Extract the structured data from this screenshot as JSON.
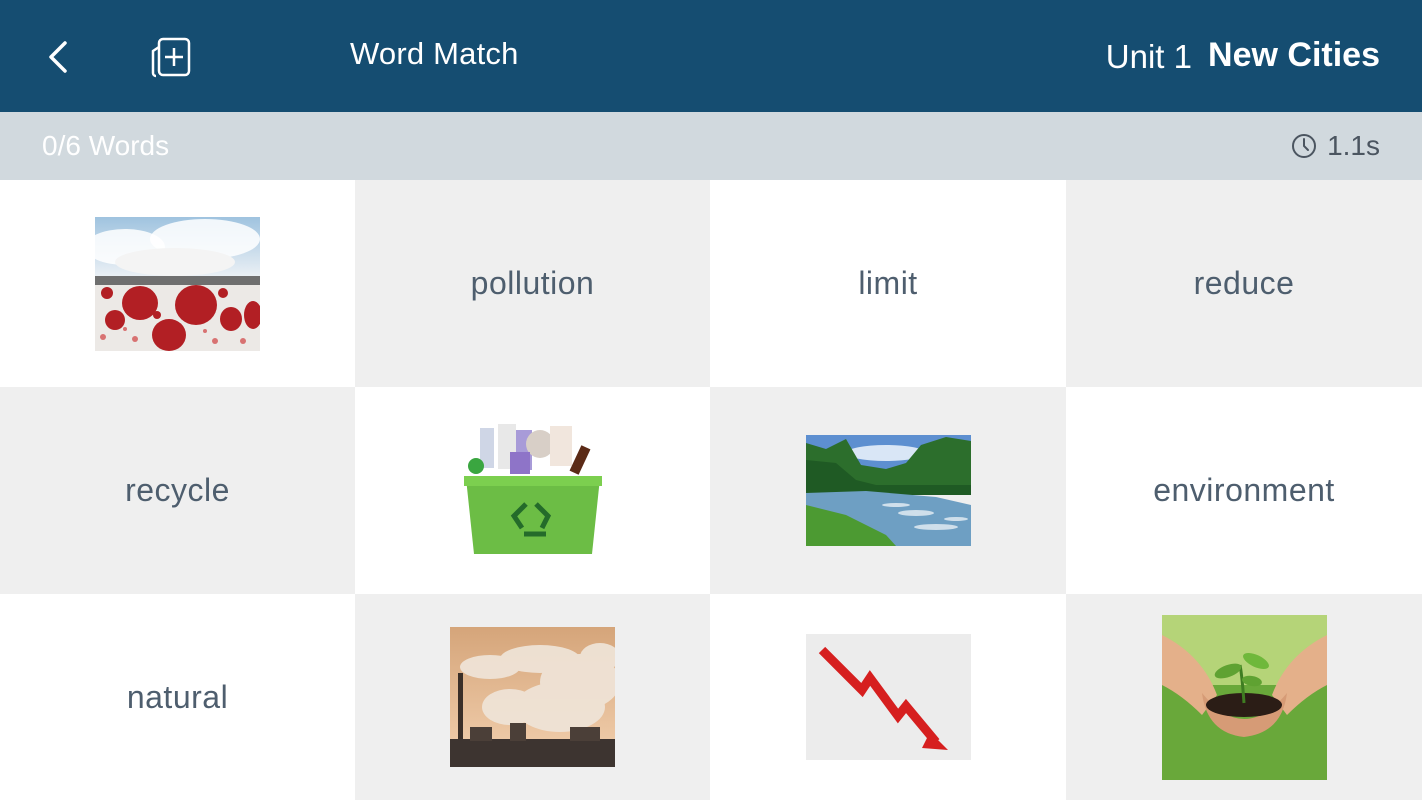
{
  "header": {
    "title": "Word Match",
    "unit": "Unit 1",
    "lesson": "New Cities",
    "back_icon": "chevron-left-icon",
    "add_icon": "add-card-icon",
    "background": "#154d71"
  },
  "status": {
    "progress": "0/6 Words",
    "timer": "1.1s",
    "timer_icon": "clock-icon"
  },
  "words": {
    "pollution": "pollution",
    "limit": "limit",
    "reduce": "reduce",
    "recycle": "recycle",
    "environment": "environment",
    "natural": "natural"
  },
  "images": [
    "hot-air-balloons-under-ceiling",
    "recycling-bin-with-waste",
    "river-in-forest",
    "smoking-factory-chimneys",
    "red-arrow-going-down",
    "seedling-in-hands"
  ]
}
